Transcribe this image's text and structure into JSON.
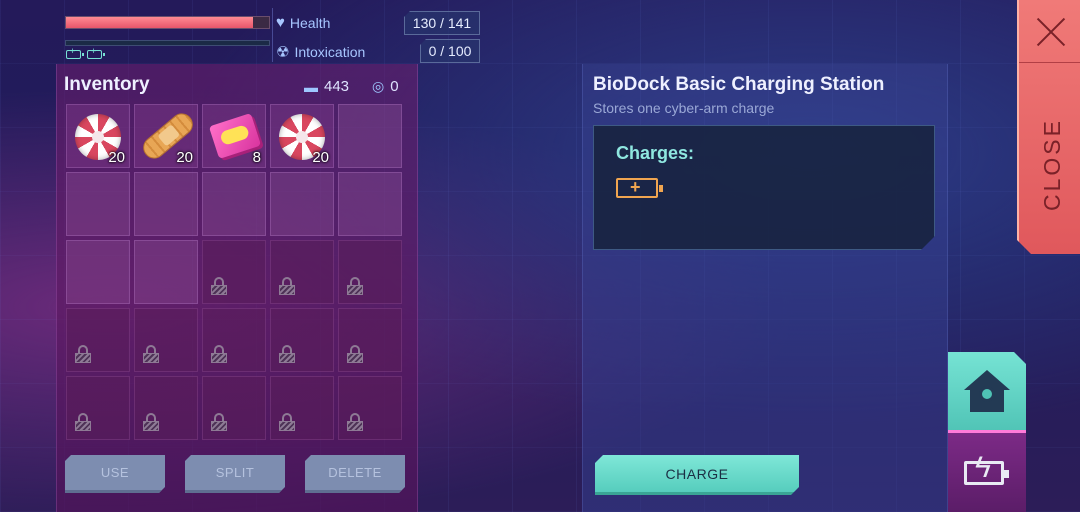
{
  "stats": {
    "health": {
      "label": "Health",
      "value": "130 / 141",
      "fraction": 0.922
    },
    "intoxication": {
      "label": "Intoxication",
      "value": "0 / 100",
      "fraction": 0.0
    }
  },
  "inventory": {
    "title": "Inventory",
    "currency_a": "443",
    "currency_b": "0",
    "slots": [
      {
        "item": "peppermint-candy",
        "qty": "20"
      },
      {
        "item": "bandage",
        "qty": "20"
      },
      {
        "item": "bubble-gum",
        "qty": "8"
      },
      {
        "item": "peppermint-candy",
        "qty": "20"
      }
    ],
    "buttons": {
      "use": "USE",
      "split": "SPLIT",
      "delete": "DELETE"
    }
  },
  "station": {
    "title": "BioDock Basic Charging Station",
    "description": "Stores one cyber-arm charge",
    "charges_label": "Charges:",
    "charge_button": "CHARGE"
  },
  "close": {
    "label": "CLOSE"
  },
  "colors": {
    "accent_teal": "#76e3d4",
    "health_red": "#e7566a",
    "close_red": "#e0585c",
    "charge_orange": "#f0a550"
  }
}
